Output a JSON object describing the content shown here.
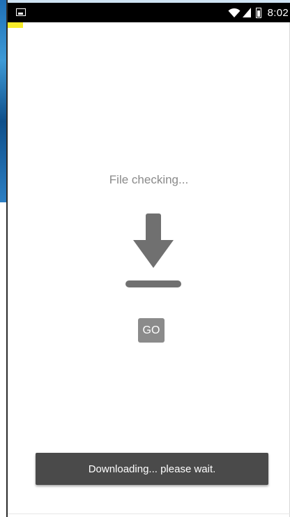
{
  "statusbar": {
    "time": "8:02",
    "icons": [
      "image-notification-icon",
      "wifi-icon",
      "signal-icon",
      "battery-icon"
    ]
  },
  "main": {
    "status_text": "File checking...",
    "icon": "download-icon",
    "go_label": "GO"
  },
  "toast": {
    "message": "Downloading... please wait."
  },
  "colors": {
    "icon_gray": "#707070",
    "button_gray": "#8b8b8b",
    "toast_bg": "#4a4a4a",
    "text_gray": "#8a8a8a"
  }
}
